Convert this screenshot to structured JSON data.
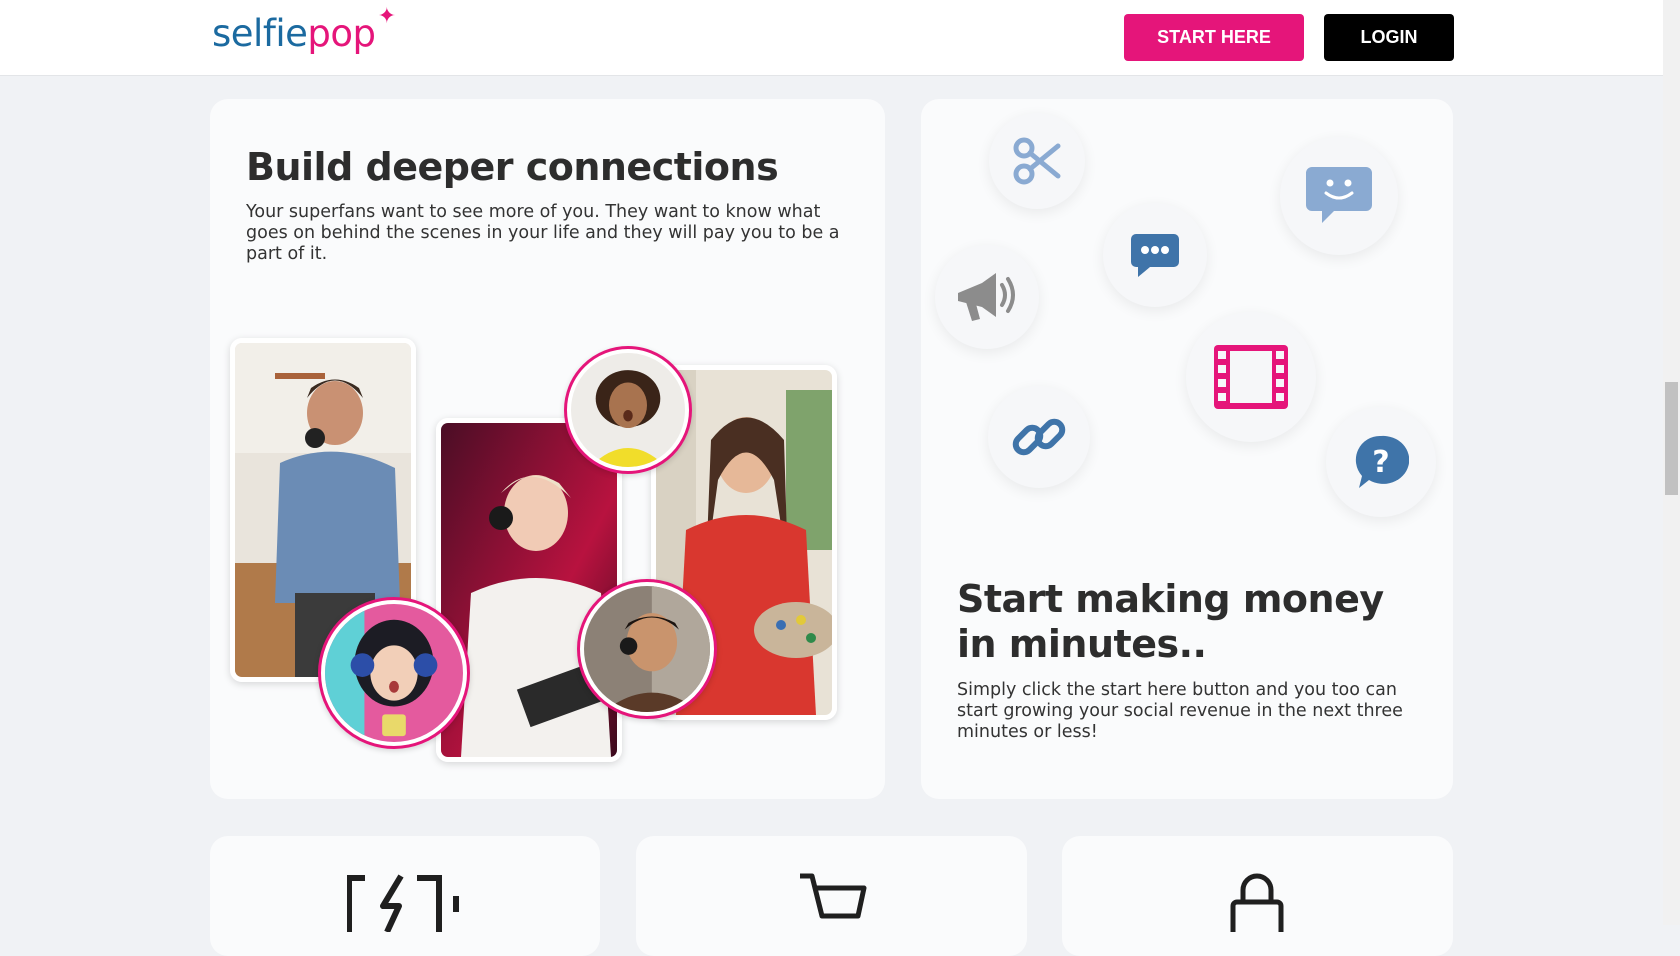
{
  "header": {
    "logo": {
      "part1": "selfie",
      "part2": "pop",
      "star": "✦"
    },
    "start_label": "START HERE",
    "login_label": "LOGIN"
  },
  "connections_card": {
    "title": "Build deeper connections",
    "text": "Your superfans want to see more of you. They want to know what goes on behind the scenes in your life and they will pay you to be a part of it."
  },
  "money_card": {
    "title": "Start making money in minutes..",
    "text": "Simply click the start here button and you too can start growing your social revenue in the next three minutes or less!",
    "icons": [
      "scissors-icon",
      "smiley-chat-icon",
      "chat-dots-icon",
      "megaphone-icon",
      "film-icon",
      "link-icon",
      "question-chat-icon"
    ]
  },
  "feature_cards": {
    "icons": [
      "battery-charge-icon",
      "cart-icon",
      "lock-icon"
    ]
  },
  "colors": {
    "brand_pink": "#e5157a",
    "brand_blue": "#1b6aa0",
    "icon_blue": "#3f74a9",
    "icon_light_blue": "#8aaad2",
    "icon_gray": "#8c8c8c"
  }
}
